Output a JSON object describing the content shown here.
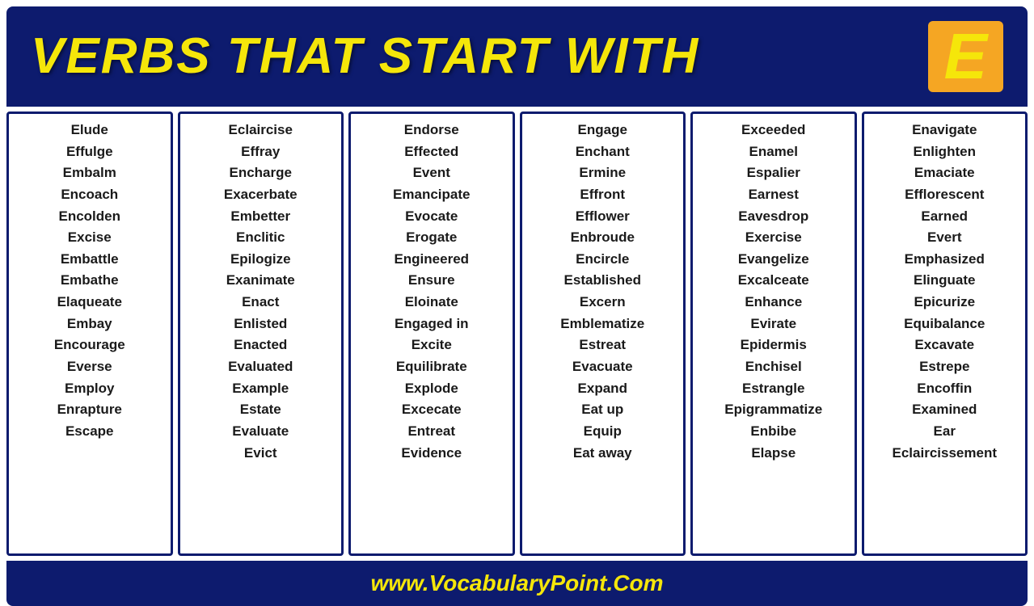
{
  "header": {
    "title": "VERBS THAT START WITH",
    "letter": "E"
  },
  "columns": [
    {
      "words": [
        "Elude",
        "Effulge",
        "Embalm",
        "Encoach",
        "Encolden",
        "Excise",
        "Embattle",
        "Embathe",
        "Elaqueate",
        "Embay",
        "Encourage",
        "Everse",
        "Employ",
        "Enrapture",
        "Escape"
      ]
    },
    {
      "words": [
        "Eclaircise",
        "Effray",
        "Encharge",
        "Exacerbate",
        "Embetter",
        "Enclitic",
        "Epilogize",
        "Exanimate",
        "Enact",
        "Enlisted",
        "Enacted",
        "Evaluated",
        "Example",
        "Estate",
        "Evaluate",
        "Evict"
      ]
    },
    {
      "words": [
        "Endorse",
        "Effected",
        "Event",
        "Emancipate",
        "Evocate",
        "Erogate",
        "Engineered",
        "Ensure",
        "Eloinate",
        "Engaged in",
        "Excite",
        "Equilibrate",
        "Explode",
        "Excecate",
        "Entreat",
        "Evidence"
      ]
    },
    {
      "words": [
        "Engage",
        "Enchant",
        "Ermine",
        "Effront",
        "Efflower",
        "Enbroude",
        "Encircle",
        "Established",
        "Excern",
        "Emblematize",
        "Estreat",
        "Evacuate",
        "Expand",
        "Eat up",
        "Equip",
        "Eat away"
      ]
    },
    {
      "words": [
        "Exceeded",
        "Enamel",
        "Espalier",
        "Earnest",
        "Eavesdrop",
        "Exercise",
        "Evangelize",
        "Excalceate",
        "Enhance",
        "Evirate",
        "Epidermis",
        "Enchisel",
        "Estrangle",
        "Epigrammatize",
        "Enbibe",
        "Elapse"
      ]
    },
    {
      "words": [
        "Enavigate",
        "Enlighten",
        "Emaciate",
        "Efflorescent",
        "Earned",
        "Evert",
        "Emphasized",
        "Elinguate",
        "Epicurize",
        "Equibalance",
        "Excavate",
        "Estrepe",
        "Encoffin",
        "Examined",
        "Ear",
        "Eclaircissement"
      ]
    }
  ],
  "footer": {
    "url": "www.VocabularyPoint.Com"
  }
}
